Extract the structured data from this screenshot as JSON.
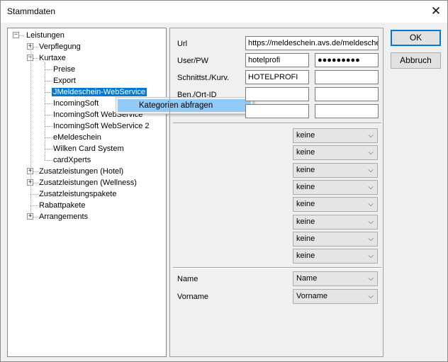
{
  "window": {
    "title": "Stammdaten"
  },
  "tree": [
    {
      "label": "Leistungen",
      "level": 0,
      "expander": "minus"
    },
    {
      "label": "Verpflegung",
      "level": 1,
      "expander": "plus"
    },
    {
      "label": "Kurtaxe",
      "level": 1,
      "expander": "minus"
    },
    {
      "label": "Preise",
      "level": 2
    },
    {
      "label": "Export",
      "level": 2
    },
    {
      "label": "JMeldeschein-WebService",
      "level": 2,
      "selected": true
    },
    {
      "label": "IncomingSoft",
      "level": 2
    },
    {
      "label": "IncomingSoft WebService",
      "level": 2
    },
    {
      "label": "IncomingSoft WebService 2",
      "level": 2
    },
    {
      "label": "eMeldeschein",
      "level": 2
    },
    {
      "label": "Wilken Card System",
      "level": 2
    },
    {
      "label": "cardXperts",
      "level": 2
    },
    {
      "label": "Zusatzleistungen (Hotel)",
      "level": 1,
      "expander": "plus"
    },
    {
      "label": "Zusatzleistungen (Wellness)",
      "level": 1,
      "expander": "plus"
    },
    {
      "label": "Zusatzleistungspakete",
      "level": 1
    },
    {
      "label": "Rabattpakete",
      "level": 1
    },
    {
      "label": "Arrangements",
      "level": 1,
      "expander": "plus"
    }
  ],
  "context_menu": {
    "item": "Kategorien abfragen"
  },
  "form": {
    "url_label": "Url",
    "url_value": "https://meldeschein.avs.de/meldeschein",
    "userpw_label": "User/PW",
    "user_value": "hotelprofi",
    "pw_value": "●●●●●●●●●",
    "schnitt_label": "Schnittst./Kurv.",
    "schnitt_value": "HOTELPROFI",
    "schnitt_value2": "",
    "ben_label": "Ben./Ort-ID",
    "ben_value": "",
    "ben_value2": "",
    "row5_value": "",
    "row5_value2": ""
  },
  "dropdowns": [
    "keine",
    "keine",
    "keine",
    "keine",
    "keine",
    "keine",
    "keine",
    "keine"
  ],
  "mappings": [
    {
      "label": "Name",
      "value": "Name"
    },
    {
      "label": "Vorname",
      "value": "Vorname"
    }
  ],
  "buttons": {
    "ok": "OK",
    "cancel": "Abbruch"
  },
  "colors": {
    "selection": "#0078d7",
    "menu_highlight": "#91c9f7"
  }
}
